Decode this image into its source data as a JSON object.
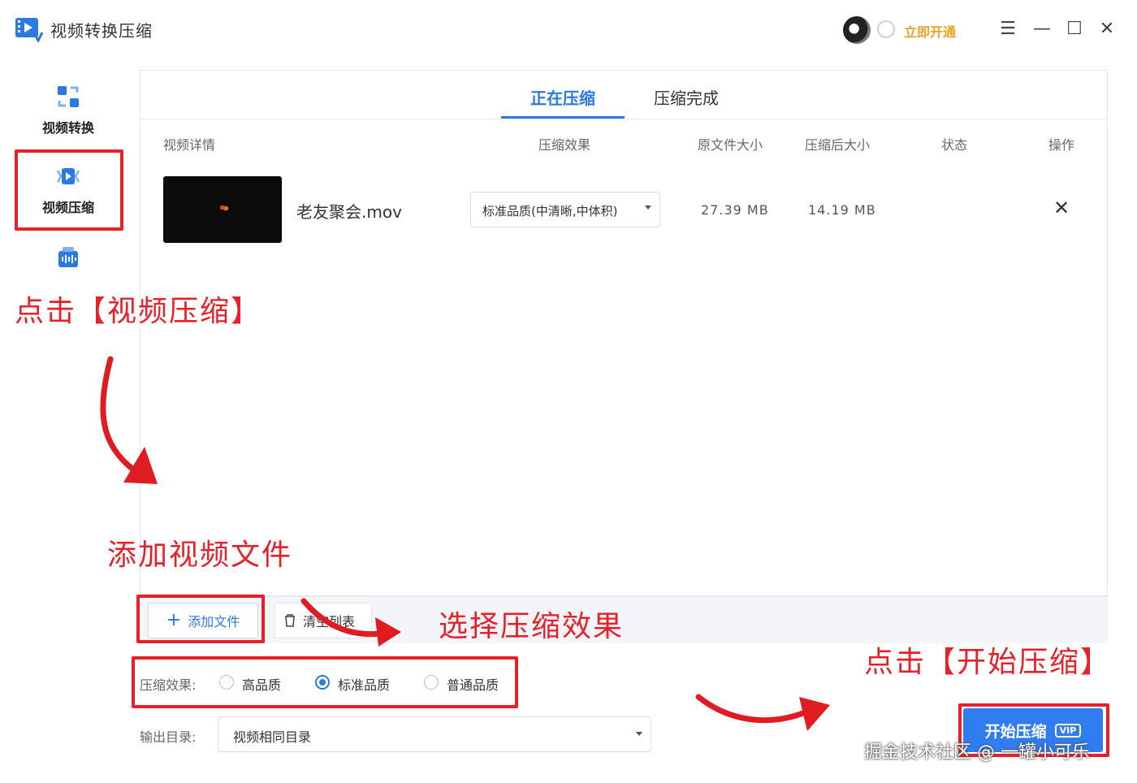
{
  "titlebar": {
    "app_title": "视频转换压缩",
    "vip_link": "立即开通",
    "menu_icon": "menu-icon",
    "minimize_icon": "minimize-icon",
    "maximize_icon": "maximize-icon",
    "close_icon": "close-icon"
  },
  "sidebar": {
    "items": [
      {
        "label": "视频转换",
        "icon": "video-convert-icon"
      },
      {
        "label": "视频压缩",
        "icon": "video-compress-icon",
        "active": true
      },
      {
        "label": "",
        "icon": "video-audio-icon"
      }
    ]
  },
  "tabs": [
    {
      "label": "正在压缩",
      "active": true
    },
    {
      "label": "压缩完成",
      "active": false
    }
  ],
  "table": {
    "headers": [
      "视频详情",
      "压缩效果",
      "原文件大小",
      "压缩后大小",
      "状态",
      "操作"
    ],
    "rows": [
      {
        "file_name": "老友聚会.mov",
        "compression": "标准品质(中清晰,中体积)",
        "original_size": "27.39 MB",
        "compressed_size": "14.19 MB",
        "status": ""
      }
    ]
  },
  "toolbar": {
    "add_file_label": "添加文件",
    "clear_list_label": "清空列表"
  },
  "options": {
    "compression_label": "压缩效果:",
    "choices": [
      "高品质",
      "标准品质",
      "普通品质"
    ],
    "selected": "标准品质",
    "output_label": "输出目录:",
    "output_value": "视频相同目录"
  },
  "start_button": {
    "label": "开始压缩",
    "badge": "VIP"
  },
  "annotations": {
    "step1": "点击【视频压缩】",
    "step2": "添加视频文件",
    "step3": "选择压缩效果",
    "step4": "点击【开始压缩】"
  },
  "watermark": "掘金技术社区 @ 一罐小可乐",
  "colors": {
    "accent": "#2a7ae2",
    "annotation": "#e8202a",
    "vip": "#f0a020"
  }
}
